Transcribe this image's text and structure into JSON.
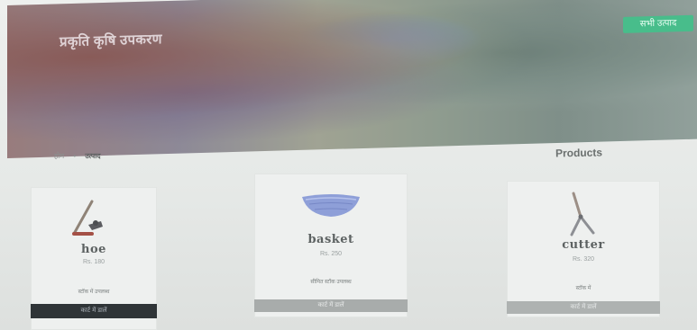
{
  "banner": {
    "title": "प्रकृति कृषि उपकरण",
    "cta_label": "सभी उत्पाद"
  },
  "breadcrumb": {
    "home": "होम",
    "current": "उत्पाद"
  },
  "section": {
    "title": "Products"
  },
  "products": [
    {
      "name": "hoe",
      "price": "Rs. 180",
      "stock": "स्टॉक में उपलब्ध",
      "button": "कार्ट में डालें",
      "icon": "hoe-icon"
    },
    {
      "name": "basket",
      "price": "Rs. 250",
      "stock": "सीमित स्टॉक उपलब्ध",
      "button": "कार्ट में डालें",
      "icon": "basket-icon"
    },
    {
      "name": "cutter",
      "price": "Rs. 320",
      "stock": "स्टॉक में",
      "button": "कार्ट में डालें",
      "icon": "cutter-icon"
    }
  ],
  "colors": {
    "accent": "#3ec089",
    "dark_button": "#2f3437",
    "muted_button": "#a8acab",
    "basket": "#8e9fd8"
  }
}
